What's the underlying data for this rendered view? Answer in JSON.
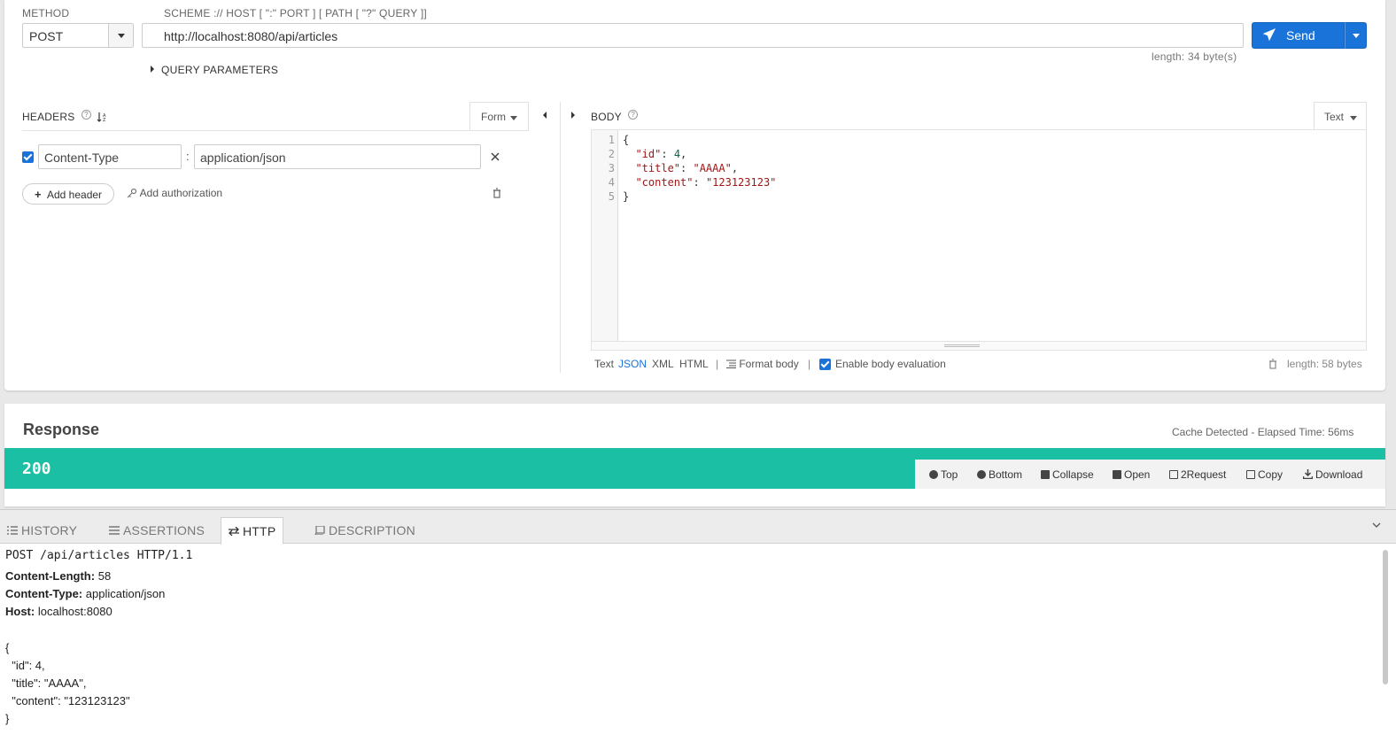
{
  "request": {
    "method_label": "METHOD",
    "method_value": "POST",
    "url_label": "SCHEME :// HOST [ \":\" PORT ] [ PATH [ \"?\" QUERY ]]",
    "url_value": "http://localhost:8080/api/articles",
    "send_label": "Send",
    "url_length": "length: 34 byte(s)",
    "query_params_label": "QUERY PARAMETERS"
  },
  "headers": {
    "title": "HEADERS",
    "form_label": "Form",
    "rows": [
      {
        "name": "Content-Type",
        "separator": ":",
        "value": "application/json",
        "enabled": true
      }
    ],
    "add_header_label": "Add header",
    "add_auth_label": "Add authorization"
  },
  "body": {
    "title": "BODY",
    "text_label": "Text",
    "line_numbers": [
      "1",
      "2",
      "3",
      "4",
      "5"
    ],
    "formats": [
      "Text",
      "JSON",
      "XML",
      "HTML"
    ],
    "active_format": "JSON",
    "format_body_label": "Format body",
    "enable_eval_label": "Enable body evaluation",
    "length": "length: 58 bytes",
    "code": {
      "open": "{",
      "k_id": "\"id\"",
      "v_id": "4",
      "k_title": "\"title\"",
      "v_title": "\"AAAA\"",
      "k_content": "\"content\"",
      "v_content": "\"123123123\"",
      "close": "}"
    }
  },
  "response": {
    "title": "Response",
    "elapsed": "Cache Detected - Elapsed Time: 56ms",
    "status_code": "200",
    "actions": [
      "Top",
      "Bottom",
      "Collapse",
      "Open",
      "2Request",
      "Copy",
      "Download"
    ]
  },
  "tabs": {
    "history": "HISTORY",
    "assertions": "ASSERTIONS",
    "http": "HTTP",
    "description": "DESCRIPTION",
    "active": "HTTP"
  },
  "http": {
    "request_line": "POST /api/articles HTTP/1.1",
    "headers": [
      {
        "name": "Content-Length:",
        "value": "58"
      },
      {
        "name": "Content-Type:",
        "value": "application/json"
      },
      {
        "name": "Host:",
        "value": "localhost:8080"
      }
    ],
    "body_lines": [
      "{",
      "  \"id\": 4,",
      "  \"title\": \"AAAA\",",
      "  \"content\": \"123123123\"",
      "}"
    ]
  },
  "colors": {
    "accent": "#1a73d9",
    "status_ok": "#1bbfa3"
  }
}
